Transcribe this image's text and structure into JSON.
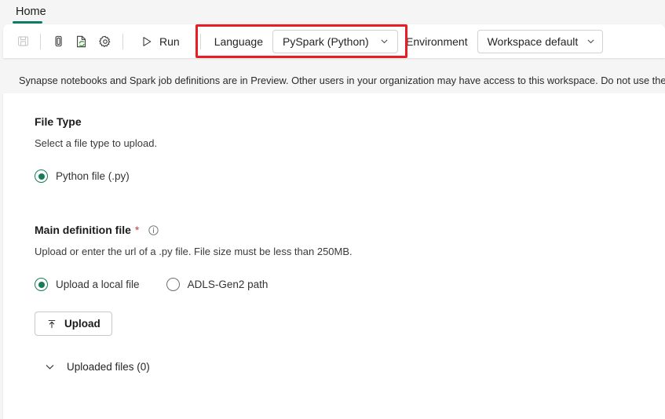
{
  "window": {
    "tab_label": "Home"
  },
  "ribbon": {
    "save_icon": "save-icon",
    "copy_icon": "copy-icon",
    "publish_icon": "publish-refresh-icon",
    "settings_icon": "gear-icon",
    "run_label": "Run",
    "run_icon": "play-triangle-icon",
    "language_label": "Language",
    "language_value": "PySpark (Python)",
    "environment_label": "Environment",
    "environment_value": "Workspace default",
    "chevron_icon": "chevron-down-icon",
    "highlight_color": "#ec1c24"
  },
  "banner": {
    "icon": "info-circle-icon",
    "text": "Synapse notebooks and Spark job definitions are in Preview. Other users in your organization may have access to this workspace. Do not use these items"
  },
  "file_type": {
    "title": "File Type",
    "description": "Select a file type to upload.",
    "options": [
      {
        "label": "Python file (.py)",
        "selected": true
      }
    ]
  },
  "main_definition": {
    "title": "Main definition file",
    "required_marker": "*",
    "info_icon": "info-circle-icon",
    "description": "Upload or enter the url of a .py file. File size must be less than 250MB.",
    "options": [
      {
        "label": "Upload a local file",
        "selected": true
      },
      {
        "label": "ADLS-Gen2 path",
        "selected": false
      }
    ],
    "upload_button_label": "Upload",
    "upload_button_icon": "upload-arrow-icon",
    "uploaded_files_label": "Uploaded files (0)",
    "uploaded_files_chevron": "chevron-down-icon"
  },
  "colors": {
    "accent_green": "#177c55",
    "tab_underline": "#107a65",
    "required_red": "#d13438",
    "highlight_red": "#ec1c24"
  }
}
